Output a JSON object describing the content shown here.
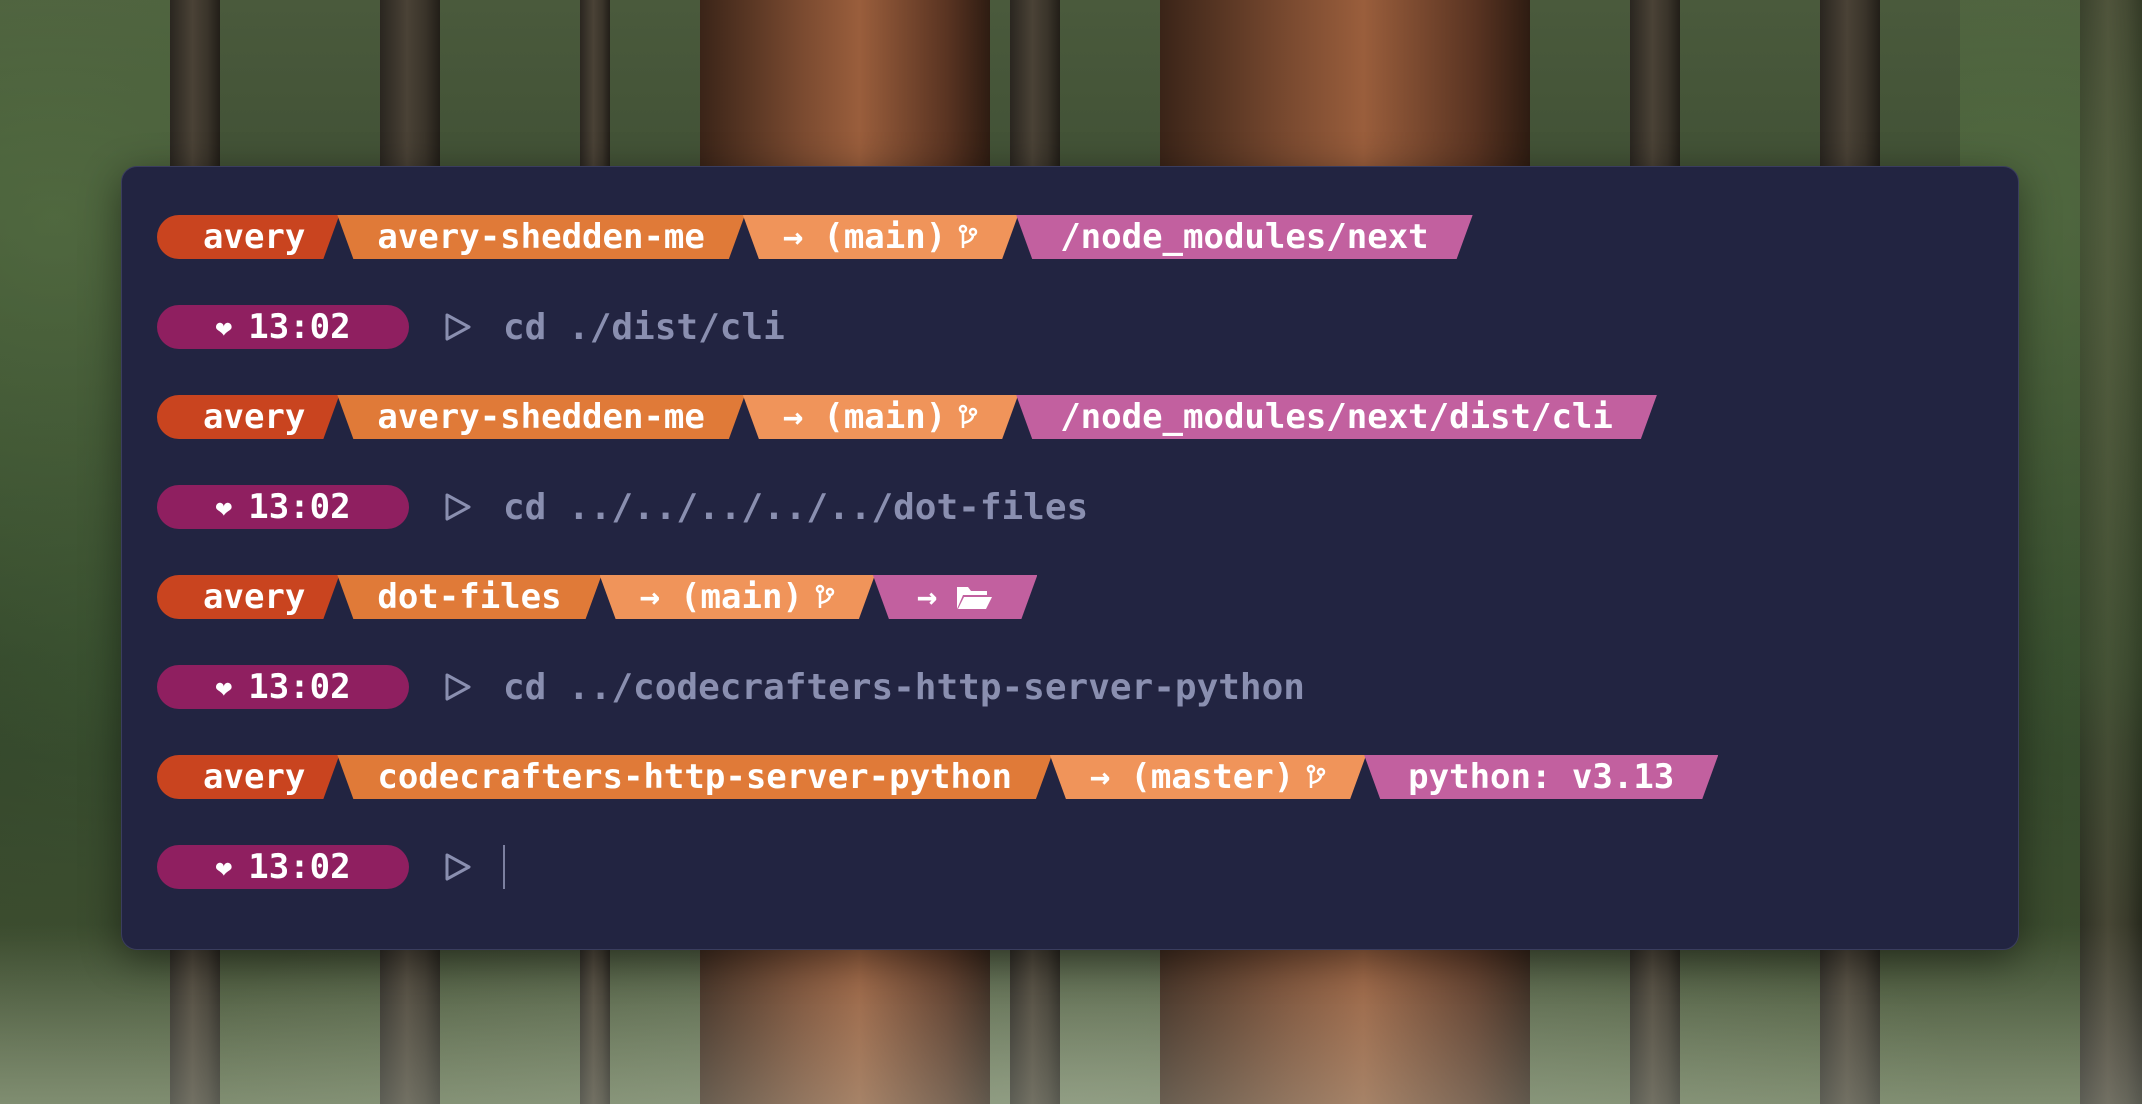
{
  "colors": {
    "terminal_bg": "#222441",
    "user_segment": "#c9441f",
    "dir_segment": "#e07a38",
    "git_segment": "#f0945a",
    "path_segment": "#c2609f",
    "time_pill": "#8f1f60",
    "command_text": "#8a8fb0"
  },
  "prompts": [
    {
      "user": "avery",
      "dir": "avery-shedden-me",
      "git_arrow": "→",
      "git_branch": "(main)",
      "branch_icon": "git-branch-icon",
      "path": "/node_modules/next"
    },
    {
      "user": "avery",
      "dir": "avery-shedden-me",
      "git_arrow": "→",
      "git_branch": "(main)",
      "branch_icon": "git-branch-icon",
      "path": "/node_modules/next/dist/cli"
    },
    {
      "user": "avery",
      "dir": "dot-files",
      "git_arrow": "→",
      "git_branch": "(main)",
      "branch_icon": "git-branch-icon",
      "path_arrow": "→",
      "path_icon": "folder-open-icon"
    },
    {
      "user": "avery",
      "dir": "codecrafters-http-server-python",
      "git_arrow": "→",
      "git_branch": "(master)",
      "branch_icon": "git-branch-icon",
      "path": "python: v3.13"
    }
  ],
  "commands": [
    {
      "heart": "❤",
      "time": "13:02",
      "prompt_icon": "play-triangle-icon",
      "text": "cd ./dist/cli"
    },
    {
      "heart": "❤",
      "time": "13:02",
      "prompt_icon": "play-triangle-icon",
      "text": "cd ../../../../../dot-files"
    },
    {
      "heart": "❤",
      "time": "13:02",
      "prompt_icon": "play-triangle-icon",
      "text": "cd ../codecrafters-http-server-python"
    },
    {
      "heart": "❤",
      "time": "13:02",
      "prompt_icon": "play-triangle-icon",
      "text": ""
    }
  ]
}
